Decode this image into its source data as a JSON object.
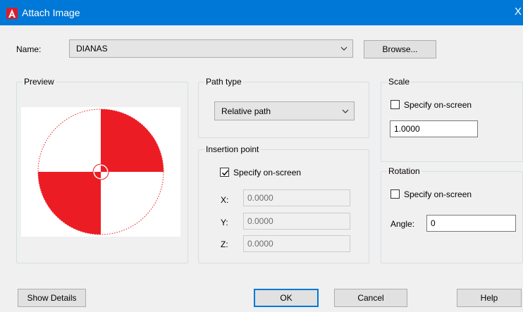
{
  "window": {
    "title": "Attach Image",
    "close_glyph": "X"
  },
  "name_row": {
    "label": "Name:",
    "value": "DIANAS",
    "browse_label": "Browse..."
  },
  "preview": {
    "title": "Preview"
  },
  "path_type": {
    "title": "Path type",
    "value": "Relative path"
  },
  "insertion": {
    "title": "Insertion point",
    "specify_label": "Specify on-screen",
    "specify_checked": true,
    "x_label": "X:",
    "x_value": "0.0000",
    "y_label": "Y:",
    "y_value": "0.0000",
    "z_label": "Z:",
    "z_value": "0.0000"
  },
  "scale": {
    "title": "Scale",
    "specify_label": "Specify on-screen",
    "specify_checked": false,
    "value": "1.0000"
  },
  "rotation": {
    "title": "Rotation",
    "specify_label": "Specify on-screen",
    "specify_checked": false,
    "angle_label": "Angle:",
    "angle_value": "0"
  },
  "buttons": {
    "show_details": "Show Details",
    "ok": "OK",
    "cancel": "Cancel",
    "help": "Help"
  },
  "colors": {
    "titlebar": "#0078d7",
    "target_red": "#ec1c24",
    "app_icon_red": "#d81e28"
  }
}
